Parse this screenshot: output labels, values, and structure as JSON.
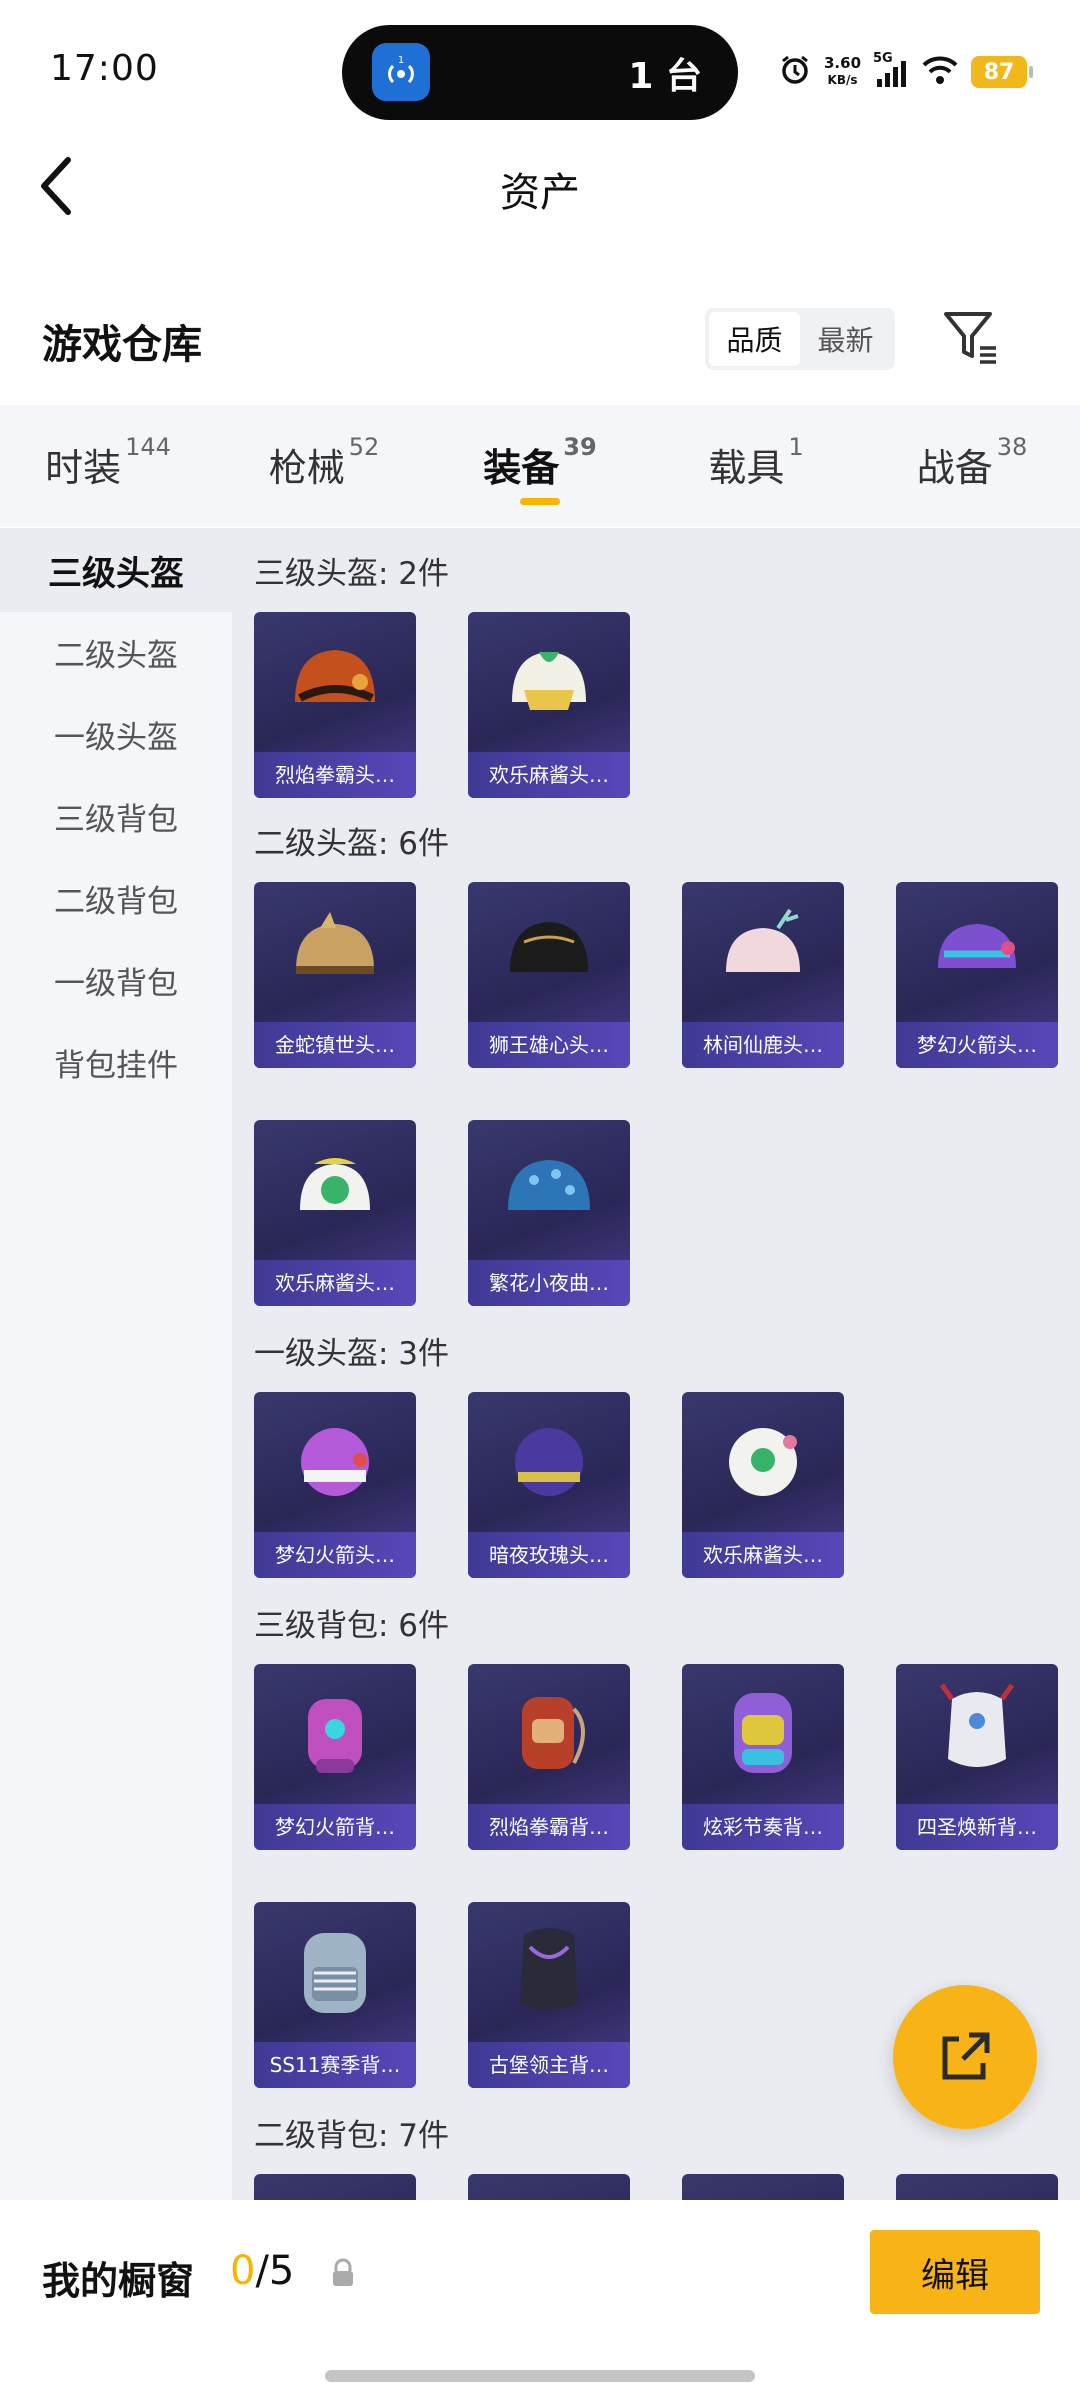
{
  "status_bar": {
    "time": "17:00",
    "island_text": "1 台",
    "island_badge": "1",
    "net_speed_value": "3.60",
    "net_speed_unit": "KB/s",
    "network": "5G",
    "battery": "87"
  },
  "header": {
    "title": "资产"
  },
  "warehouse": {
    "title": "游戏仓库",
    "sort_options": [
      "品质",
      "最新"
    ],
    "active_sort": "品质"
  },
  "category_tabs": [
    {
      "label": "时装",
      "count": "144"
    },
    {
      "label": "枪械",
      "count": "52"
    },
    {
      "label": "装备",
      "count": "39"
    },
    {
      "label": "载具",
      "count": "1"
    },
    {
      "label": "战备",
      "count": "38"
    }
  ],
  "active_category": "装备",
  "side_nav": [
    "三级头盔",
    "二级头盔",
    "一级头盔",
    "三级背包",
    "二级背包",
    "一级背包",
    "背包挂件"
  ],
  "active_side": "三级头盔",
  "groups": [
    {
      "title": "三级头盔: 2件",
      "items": [
        "烈焰拳霸头…",
        "欢乐麻酱头…"
      ]
    },
    {
      "title": "二级头盔: 6件",
      "items": [
        "金蛇镇世头…",
        "狮王雄心头…",
        "林间仙鹿头…",
        "梦幻火箭头…",
        "欢乐麻酱头…",
        "繁花小夜曲…"
      ]
    },
    {
      "title": "一级头盔: 3件",
      "items": [
        "梦幻火箭头…",
        "暗夜玫瑰头…",
        "欢乐麻酱头…"
      ]
    },
    {
      "title": "三级背包: 6件",
      "items": [
        "梦幻火箭背…",
        "烈焰拳霸背…",
        "炫彩节奏背…",
        "四圣焕新背…",
        "SS11赛季背…",
        "古堡领主背…"
      ]
    },
    {
      "title": "二级背包: 7件",
      "items": []
    }
  ],
  "bottom": {
    "showcase_label": "我的橱窗",
    "showcase_current": "0",
    "showcase_total": "/5",
    "edit_label": "编辑"
  },
  "colors": {
    "accent": "#f8b416",
    "card": "#2c2a5c"
  }
}
